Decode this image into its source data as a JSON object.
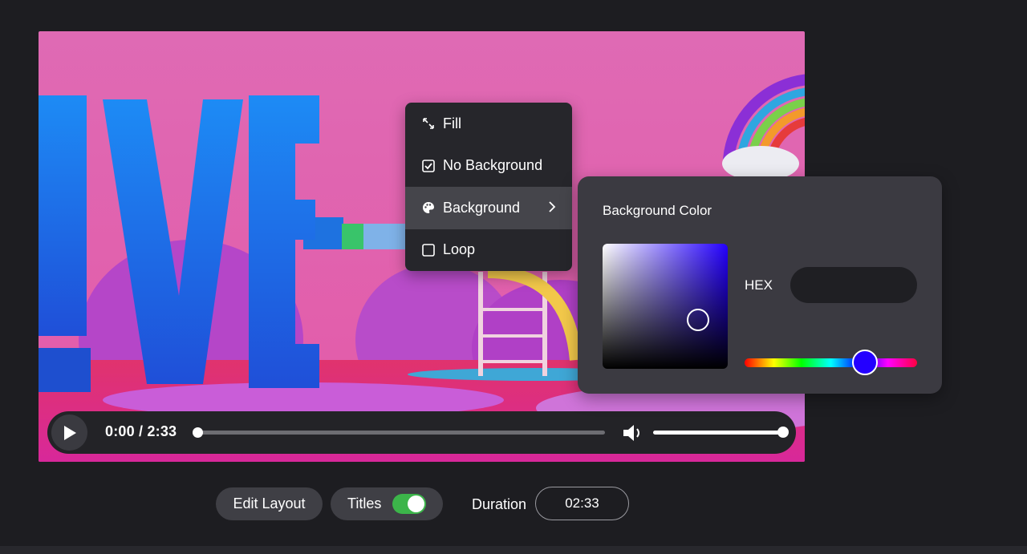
{
  "player": {
    "time_display": "0:00 / 2:33",
    "progress_fraction": 0.0,
    "volume_fraction": 1.0
  },
  "context_menu": {
    "items": [
      {
        "label": "Fill",
        "icon": "expand-arrows-icon"
      },
      {
        "label": "No Background",
        "icon": "checkbox-checked-icon",
        "checked": true
      },
      {
        "label": "Background",
        "icon": "palette-icon",
        "has_submenu": true,
        "active": true
      },
      {
        "label": "Loop",
        "icon": "checkbox-empty-icon",
        "checked": false
      }
    ]
  },
  "color_panel": {
    "title": "Background Color",
    "hex_label": "HEX",
    "hex_value": "",
    "selected_hue_color": "#2400ff"
  },
  "toolbar": {
    "edit_layout_label": "Edit Layout",
    "titles_label": "Titles",
    "titles_enabled": true,
    "duration_label": "Duration",
    "duration_value": "02:33"
  },
  "colors": {
    "background": "#1d1d21",
    "toggle_on": "#3cb54a",
    "video_pink": "#e066b4"
  }
}
